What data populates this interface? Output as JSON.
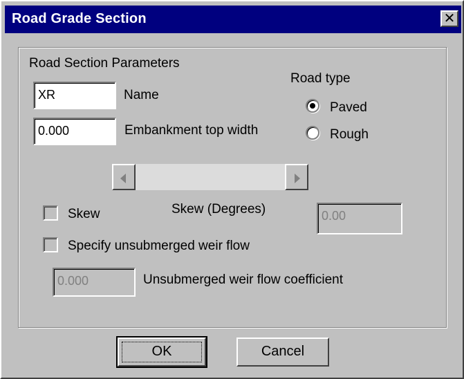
{
  "window": {
    "title": "Road Grade Section",
    "close_glyph": "✕"
  },
  "group": {
    "title": "Road Section Parameters"
  },
  "name_field": {
    "value": "XR",
    "label": "Name"
  },
  "embankment_field": {
    "value": "0.000",
    "label": "Embankment top width"
  },
  "road_type": {
    "label": "Road type",
    "options": [
      {
        "label": "Paved",
        "selected": true
      },
      {
        "label": "Rough",
        "selected": false
      }
    ]
  },
  "skew": {
    "checkbox_label": "Skew",
    "degrees_label": "Skew (Degrees)",
    "value": "0.00",
    "checked": false,
    "enabled": false
  },
  "weir": {
    "checkbox_label": "Specify unsubmerged weir flow",
    "checked": false,
    "coefficient_value": "0.000",
    "coefficient_label": "Unsubmerged weir flow coefficient"
  },
  "buttons": {
    "ok": "OK",
    "cancel": "Cancel"
  },
  "colors": {
    "title_bar": "#00007f",
    "face": "#c0c0c0",
    "scroll_track": "#dcdcdc",
    "disabled_text": "#808080"
  }
}
